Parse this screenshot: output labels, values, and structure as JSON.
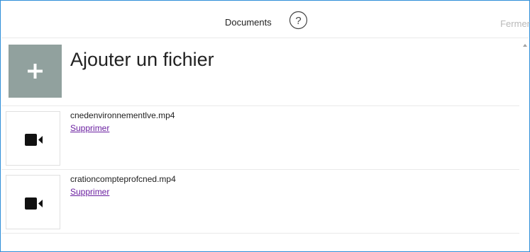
{
  "header": {
    "title": "Documents",
    "close_label": "Fermer"
  },
  "add_file": {
    "label": "Ajouter un fichier",
    "icon": "plus-icon"
  },
  "files": [
    {
      "name": "cnedenvironnementlve.mp4",
      "delete_label": "Supprimer",
      "icon": "video-camera-icon"
    },
    {
      "name": "crationcompteprofcned.mp4",
      "delete_label": "Supprimer",
      "icon": "video-camera-icon"
    }
  ],
  "colors": {
    "accent_border": "#2f8fd8",
    "add_tile": "#91a19e",
    "link": "#6a1fa0",
    "close_text": "#b9b9b9"
  }
}
